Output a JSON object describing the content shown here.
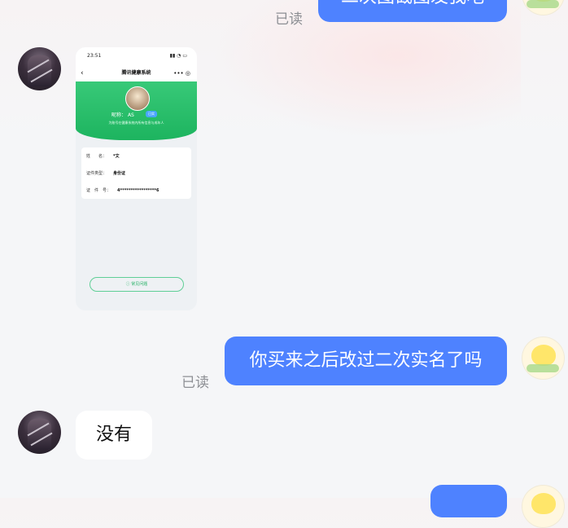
{
  "messages": [
    {
      "side": "right",
      "text": "二次图截图发我吧",
      "read": "已读"
    },
    {
      "side": "left",
      "type": "image",
      "screenshot": {
        "time": "23:51",
        "title": "腾讯健康系统",
        "nickname_label": "昵称：",
        "nickname_value": "AS",
        "tag": "已实",
        "subtitle": "为账号在健康系统内所有信息与成年人",
        "fields": [
          {
            "label": "姓　　名：",
            "value": "*文"
          },
          {
            "label": "证件类型：",
            "value": "身份证"
          },
          {
            "label": "证　件　号：",
            "value": "4*****************6"
          }
        ],
        "button": "常见问题"
      }
    },
    {
      "side": "right",
      "text": "你买来之后改过二次实名了吗",
      "read": "已读"
    },
    {
      "side": "left",
      "text": "没有"
    }
  ],
  "colors": {
    "bubble_blue": "#4e82ff",
    "bubble_white": "#ffffff",
    "read_text": "#8d8f94",
    "green": "#1db45f"
  }
}
